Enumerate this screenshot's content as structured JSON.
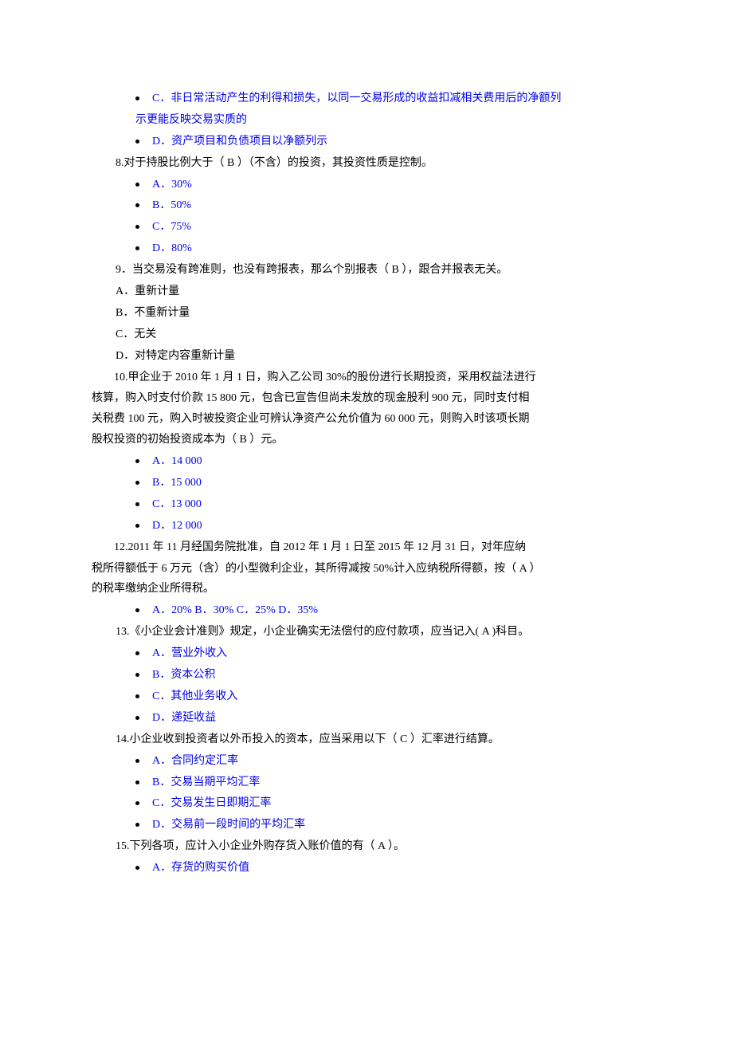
{
  "q7": {
    "optC_line1": "C．非日常活动产生的利得和损失，以同一交易形成的收益扣减相关费用后的净额列",
    "optC_line2": "示更能反映交易实质的",
    "optD": "D．资产项目和负债项目以净额列示"
  },
  "q8": {
    "text": "8.对于持股比例大于（ B ）（不含）的投资，其投资性质是控制。",
    "optA": "A．30%",
    "optB": "B．50%",
    "optC": "C．75%",
    "optD": "D．80%"
  },
  "q9": {
    "text": "9．当交易没有跨准则，也没有跨报表，那么个别报表（ B ），跟合并报表无关。",
    "optA": "A．重新计量",
    "optB": "B．不重新计量",
    "optC": "C．无关",
    "optD": "D．对特定内容重新计量"
  },
  "q10": {
    "line1": "10.甲企业于 2010 年 1 月 1 日，购入乙公司 30%的股份进行长期投资，采用权益法进行",
    "line2": "核算，购入时支付价款 15 800 元，包含已宣告但尚未发放的现金股利 900 元，同时支付相",
    "line3": "关税费 100 元，购入时被投资企业可辨认净资产公允价值为 60 000 元，则购入时该项长期",
    "line4": "股权投资的初始投资成本为（ B ）元。",
    "optA": "A．14 000",
    "optB": "B．15 000",
    "optC": "C．13 000",
    "optD": "D．12 000"
  },
  "q12": {
    "line1": "12.2011 年 11 月经国务院批准，自 2012 年 1 月 1 日至 2015 年 12 月 31 日，对年应纳",
    "line2": "税所得额低于 6 万元（含）的小型微利企业，其所得减按 50%计入应纳税所得额，按（ A ）",
    "line3": "的税率缴纳企业所得税。",
    "opts": "A．20% B．30% C．25% D．35%"
  },
  "q13": {
    "text": "13.《小企业会计准则》规定，小企业确实无法偿付的应付款项，应当记入( A )科目。",
    "optA": "A．营业外收入",
    "optB": "B．资本公积",
    "optC": "C．其他业务收入",
    "optD": "D．递延收益"
  },
  "q14": {
    "text": "14.小企业收到投资者以外币投入的资本，应当采用以下（ C ）汇率进行结算。",
    "optA": "A．合同约定汇率",
    "optB": "B．交易当期平均汇率",
    "optC": "C．交易发生日即期汇率",
    "optD": "D．交易前一段时间的平均汇率"
  },
  "q15": {
    "text": "15.下列各项，应计入小企业外购存货入账价值的有（ A ）。",
    "optA": "A．存货的购买价值"
  }
}
